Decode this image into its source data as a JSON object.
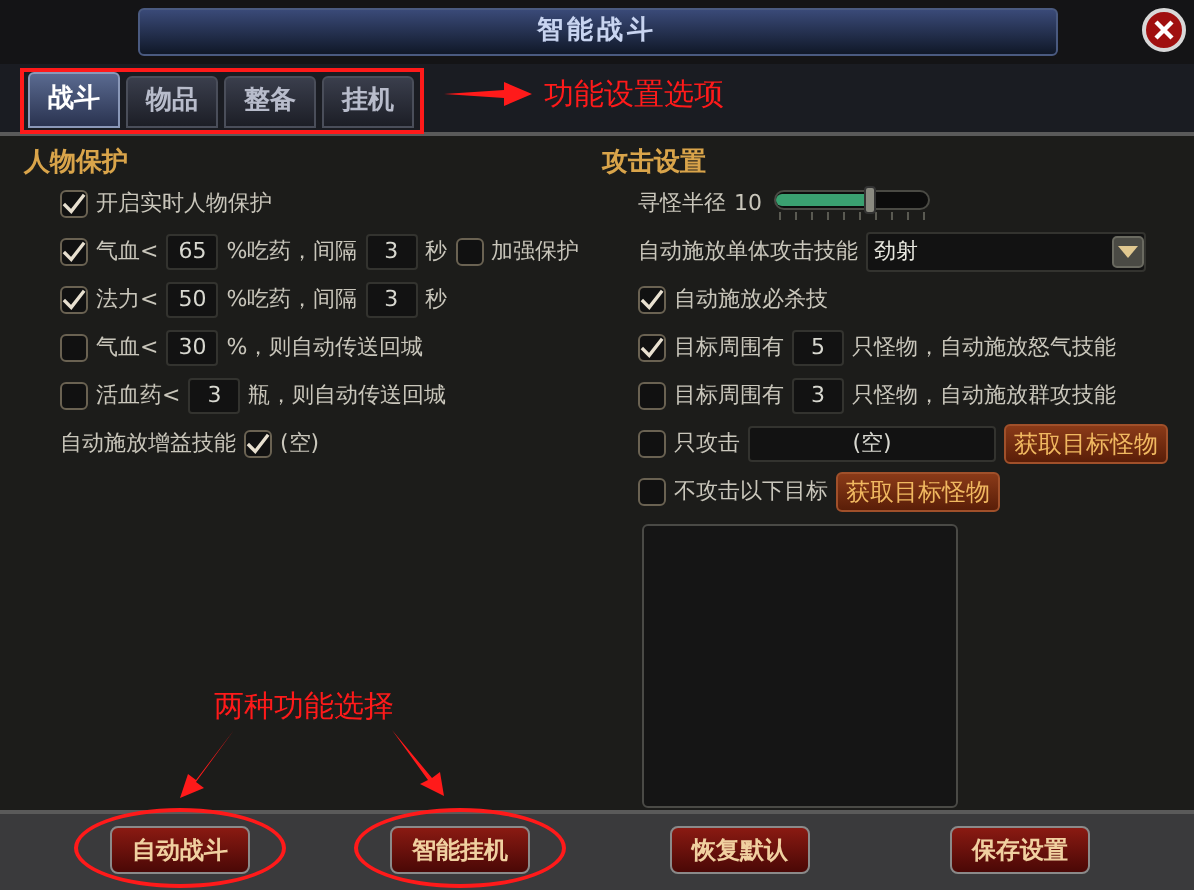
{
  "window": {
    "title": "智能战斗"
  },
  "tabs": [
    {
      "label": "战斗",
      "selected": true
    },
    {
      "label": "物品",
      "selected": false
    },
    {
      "label": "整备",
      "selected": false
    },
    {
      "label": "挂机",
      "selected": false
    }
  ],
  "tab_annotation": {
    "text": "功能设置选项"
  },
  "character_protection": {
    "title": "人物保护",
    "rows": [
      {
        "parts": [
          {
            "kind": "checkbox",
            "checked": true
          },
          {
            "kind": "text",
            "text": "开启实时人物保护"
          }
        ]
      },
      {
        "parts": [
          {
            "kind": "checkbox",
            "checked": true
          },
          {
            "kind": "text",
            "text": "气血<"
          },
          {
            "kind": "input",
            "value": "65"
          },
          {
            "kind": "text",
            "text": "%吃药，间隔"
          },
          {
            "kind": "input",
            "value": "3"
          },
          {
            "kind": "text",
            "text": "秒"
          },
          {
            "kind": "checkbox",
            "checked": false
          },
          {
            "kind": "text",
            "text": "加强保护"
          }
        ]
      },
      {
        "parts": [
          {
            "kind": "checkbox",
            "checked": true
          },
          {
            "kind": "text",
            "text": "法力<"
          },
          {
            "kind": "input",
            "value": "50"
          },
          {
            "kind": "text",
            "text": "%吃药，间隔"
          },
          {
            "kind": "input",
            "value": "3"
          },
          {
            "kind": "text",
            "text": "秒"
          }
        ]
      },
      {
        "parts": [
          {
            "kind": "checkbox",
            "checked": false
          },
          {
            "kind": "text",
            "text": "气血<"
          },
          {
            "kind": "input",
            "value": "30"
          },
          {
            "kind": "text",
            "text": "%，则自动传送回城"
          }
        ]
      },
      {
        "parts": [
          {
            "kind": "checkbox",
            "checked": false
          },
          {
            "kind": "text",
            "text": "活血药<"
          },
          {
            "kind": "input",
            "value": "3"
          },
          {
            "kind": "text",
            "text": "瓶，则自动传送回城"
          }
        ]
      },
      {
        "parts": [
          {
            "kind": "text",
            "text": "自动施放增益技能"
          },
          {
            "kind": "checkbox",
            "checked": true
          },
          {
            "kind": "text",
            "text": "(空)"
          }
        ]
      }
    ]
  },
  "attack_settings": {
    "title": "攻击设置",
    "rows": [
      {
        "parts": [
          {
            "kind": "text",
            "text": "寻怪半径"
          },
          {
            "kind": "text",
            "text": "10"
          },
          {
            "kind": "slider",
            "level": 0.62
          }
        ]
      },
      {
        "parts": [
          {
            "kind": "text",
            "text": "自动施放单体攻击技能"
          },
          {
            "kind": "dropdown",
            "value": "劲射"
          }
        ]
      },
      {
        "parts": [
          {
            "kind": "checkbox",
            "checked": true
          },
          {
            "kind": "text",
            "text": "自动施放必杀技"
          }
        ]
      },
      {
        "parts": [
          {
            "kind": "checkbox",
            "checked": true
          },
          {
            "kind": "text",
            "text": "目标周围有"
          },
          {
            "kind": "input",
            "value": "5"
          },
          {
            "kind": "text",
            "text": "只怪物，自动施放怒气技能"
          }
        ]
      },
      {
        "parts": [
          {
            "kind": "checkbox",
            "checked": false
          },
          {
            "kind": "text",
            "text": "目标周围有"
          },
          {
            "kind": "input",
            "value": "3"
          },
          {
            "kind": "text",
            "text": "只怪物，自动施放群攻技能"
          }
        ]
      },
      {
        "parts": [
          {
            "kind": "checkbox",
            "checked": false
          },
          {
            "kind": "text",
            "text": "只攻击"
          },
          {
            "kind": "field",
            "value": "(空)"
          },
          {
            "kind": "button",
            "label": "获取目标怪物"
          }
        ]
      },
      {
        "parts": [
          {
            "kind": "checkbox",
            "checked": false
          },
          {
            "kind": "text",
            "text": "不攻击以下目标"
          },
          {
            "kind": "button",
            "label": "获取目标怪物"
          }
        ]
      },
      {
        "parts": [
          {
            "kind": "listbox"
          }
        ]
      }
    ]
  },
  "footer_annotation": {
    "text": "两种功能选择"
  },
  "buttons": [
    {
      "label": "自动战斗",
      "circled": true
    },
    {
      "label": "智能挂机",
      "circled": true
    },
    {
      "label": "恢复默认",
      "circled": false
    },
    {
      "label": "保存设置",
      "circled": false
    }
  ]
}
